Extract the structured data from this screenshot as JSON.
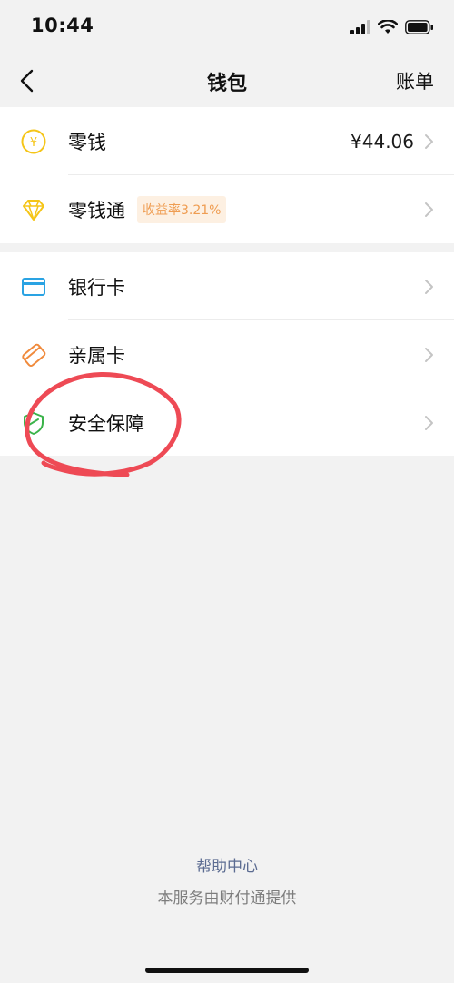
{
  "status_bar": {
    "time": "10:44"
  },
  "nav": {
    "title": "钱包",
    "right_label": "账单"
  },
  "wallet": {
    "balance_label": "零钱",
    "balance_value": "¥44.06",
    "fund_label": "零钱通",
    "fund_badge": "收益率3.21%"
  },
  "cards": {
    "bank_card": "银行卡",
    "family_card": "亲属卡",
    "security": "安全保障"
  },
  "footer": {
    "help": "帮助中心",
    "provider": "本服务由财付通提供"
  },
  "colors": {
    "coin": "#f5c518",
    "diamond": "#f5c518",
    "bank": "#2aa3e3",
    "family": "#f08a3c",
    "shield": "#3bb34a",
    "annotation": "#ee4a55"
  }
}
